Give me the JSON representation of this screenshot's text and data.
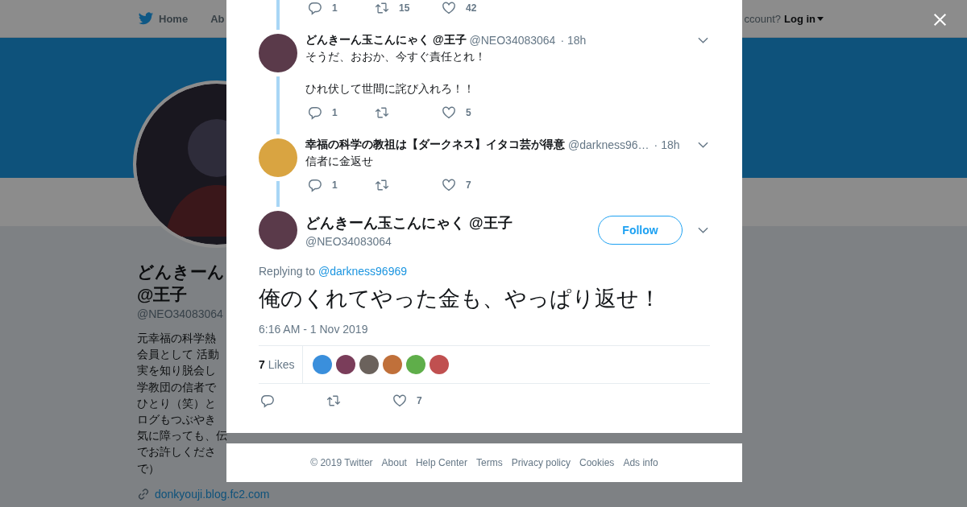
{
  "nav": {
    "items": [
      {
        "label": "Home",
        "kind": "home"
      },
      {
        "label": "Ab",
        "kind": "text"
      }
    ],
    "account_prompt": "ccount?",
    "login": "Log in"
  },
  "profile": {
    "name": "どんきーん",
    "name_line2": "@王子",
    "handle": "@NEO34083064",
    "bio_lines": [
      "元幸福の科学熱",
      "会員として 活動",
      "実を知り脱会し",
      "学教団の信者で",
      "ひとり（笑）と",
      "ログもつぶやき",
      "気に障っても、伝",
      "でお許しくださ",
      "で）"
    ],
    "link": "donkyouji.blog.fc2.com"
  },
  "thread": {
    "top_actions": {
      "replies": "1",
      "retweets": "15",
      "likes": "42"
    },
    "replies": [
      {
        "name": "どんきーん玉こんにゃく @王子",
        "handle": "@NEO34083064",
        "time": "· 18h",
        "color": "#5a3a4a",
        "paragraphs": [
          "そうだ、おおか、今すぐ責任とれ！",
          "ひれ伏して世間に詫び入れろ！！"
        ],
        "actions": {
          "replies": "1",
          "likes": "5"
        }
      },
      {
        "name": "幸福の科学の教祖は【ダークネス】イタコ芸が得意",
        "handle": "@darkness96…",
        "time": "· 18h",
        "color": "#d9a441",
        "paragraphs": [
          "信者に金返せ"
        ],
        "actions": {
          "replies": "1",
          "likes": "7"
        }
      }
    ]
  },
  "tweet": {
    "name": "どんきーん玉こんにゃく @王子",
    "handle": "@NEO34083064",
    "color": "#5a3a4a",
    "follow": "Follow",
    "replying_label": "Replying to",
    "replying_to": "@darkness96969",
    "text": "俺のくれてやった金も、やっぱり返せ！",
    "timestamp": "6:16 AM - 1 Nov 2019",
    "likes_count": "7",
    "likes_label": "Likes",
    "likers": [
      {
        "color": "#3a8fdc"
      },
      {
        "color": "#7a3d5a"
      },
      {
        "color": "#6b625c"
      },
      {
        "color": "#c0703a"
      },
      {
        "color": "#5fae4a"
      },
      {
        "color": "#c05050"
      }
    ],
    "actions": {
      "likes": "7"
    }
  },
  "footer": [
    "© 2019 Twitter",
    "About",
    "Help Center",
    "Terms",
    "Privacy policy",
    "Cookies",
    "Ads info"
  ]
}
